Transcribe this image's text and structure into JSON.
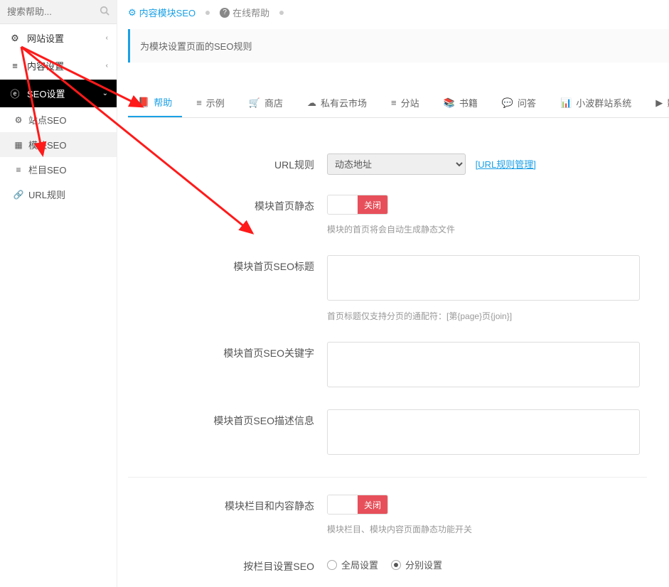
{
  "sidebar": {
    "search_placeholder": "搜索帮助...",
    "items": [
      {
        "icon": "⚙",
        "label": "网站设置",
        "chev": "‹"
      },
      {
        "icon": "≡",
        "label": "内容设置",
        "chev": "‹"
      },
      {
        "icon": "ⓔ",
        "label": "SEO设置",
        "chev": "⌄",
        "active": true
      }
    ],
    "sub": [
      {
        "icon": "⚙",
        "label": "站点SEO"
      },
      {
        "icon": "▦",
        "label": "模块SEO",
        "cur": true
      },
      {
        "icon": "≡",
        "label": "栏目SEO"
      },
      {
        "icon": "🔗",
        "label": "URL规则"
      }
    ]
  },
  "breadcrumb": {
    "b1_icon": "⚙",
    "b1": "内容模块SEO",
    "b2_icon": "?",
    "b2": "在线帮助"
  },
  "notice": "为模块设置页面的SEO规则",
  "tabs": [
    {
      "icon": "📕",
      "label": "帮助",
      "active": true
    },
    {
      "icon": "≡",
      "label": "示例"
    },
    {
      "icon": "🛒",
      "label": "商店"
    },
    {
      "icon": "☁",
      "label": "私有云市场"
    },
    {
      "icon": "≡",
      "label": "分站"
    },
    {
      "icon": "📚",
      "label": "书籍"
    },
    {
      "icon": "💬",
      "label": "问答"
    },
    {
      "icon": "📊",
      "label": "小波群站系统"
    },
    {
      "icon": "▶",
      "label": "影"
    }
  ],
  "form": {
    "url_rule_label": "URL规则",
    "url_rule_value": "动态地址",
    "url_rule_link": "[URL规则管理]",
    "home_static_label": "模块首页静态",
    "switch_off": "关闭",
    "home_static_hint": "模块的首页将会自动生成静态文件",
    "seo_title_label": "模块首页SEO标题",
    "seo_title_hint": "首页标题仅支持分页的通配符：[第{page}页{join}]",
    "seo_keyword_label": "模块首页SEO关键字",
    "seo_desc_label": "模块首页SEO描述信息",
    "col_static_label": "模块栏目和内容静态",
    "col_static_hint": "模块栏目、模块内容页面静态功能开关",
    "col_seo_label": "按栏目设置SEO",
    "radio_global": "全局设置",
    "radio_sep": "分别设置"
  }
}
